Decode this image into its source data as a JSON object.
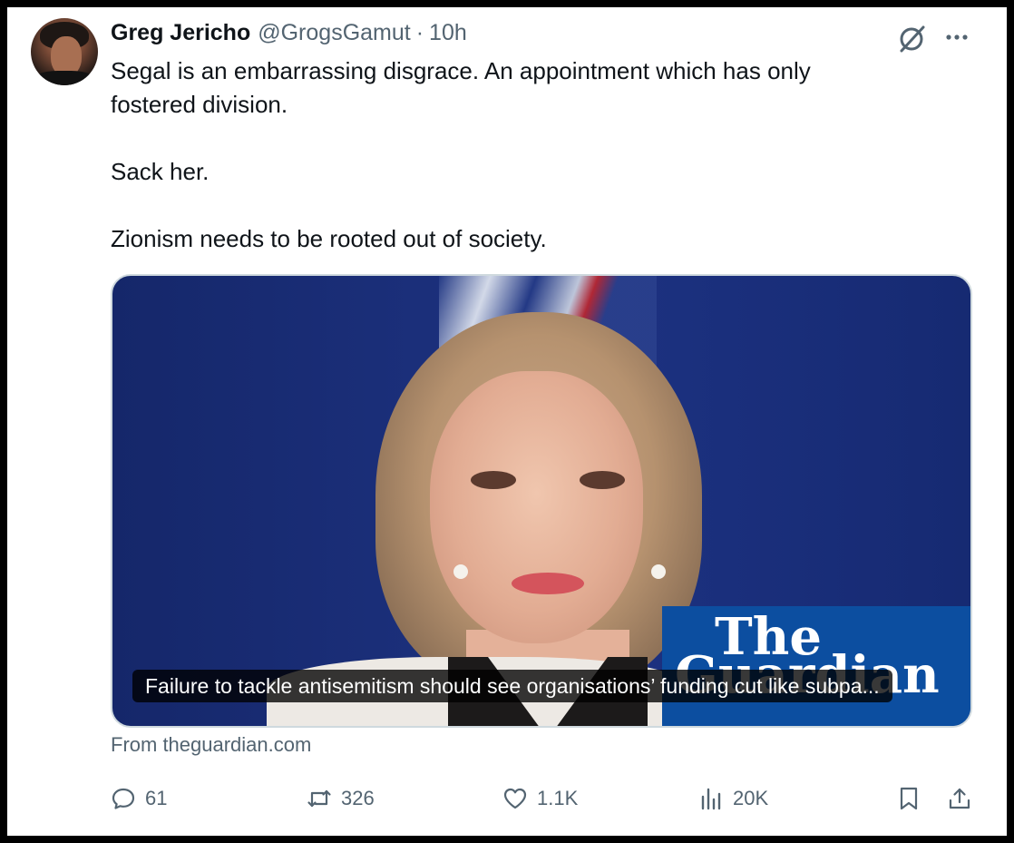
{
  "tweet": {
    "author_name": "Greg Jericho",
    "author_handle": "@GrogsGamut",
    "separator": "·",
    "time": "10h",
    "text": "Segal is an embarrassing disgrace. An appointment which has only\nfostered division.\n\nSack her.\n\nZionism needs to be rooted out of society."
  },
  "card": {
    "caption": "Failure to tackle antisemitism should see organisations’ funding cut like subpa...",
    "source": "From theguardian.com",
    "logo_line1": "The",
    "logo_line2": "Guardian"
  },
  "actions": {
    "replies": "61",
    "reposts": "326",
    "likes": "1.1K",
    "views": "20K"
  },
  "icons": {
    "header": [
      "grok-icon",
      "more-icon"
    ],
    "actions": [
      "reply-icon",
      "repost-icon",
      "like-icon",
      "views-icon",
      "bookmark-icon",
      "share-icon"
    ]
  },
  "colors": {
    "text_primary": "#0f1419",
    "text_secondary": "#536471",
    "card_border": "#cfd9de"
  }
}
